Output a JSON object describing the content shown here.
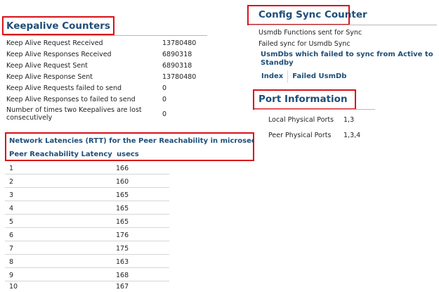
{
  "keepalive": {
    "title": "Keepalive Counters",
    "rows": [
      {
        "label": "Keep Alive Request Received",
        "value": "13780480"
      },
      {
        "label": "Keep Alive Responses Received",
        "value": "6890318"
      },
      {
        "label": "Keep Alive Request Sent",
        "value": "6890318"
      },
      {
        "label": "Keep Alive Response Sent",
        "value": "13780480"
      },
      {
        "label": "Keep Alive Requests failed to send",
        "value": "0"
      },
      {
        "label": "Keep Alive Responses to failed to send",
        "value": "0"
      },
      {
        "label": "Number of times two Keepalives are lost consecutively",
        "value": "0"
      }
    ]
  },
  "latency": {
    "title": "Network Latencies (RTT) for the Peer Reachability in microseconds",
    "col_latency": "Peer Reachability Latency",
    "col_usecs": "usecs",
    "rows": [
      {
        "n": "1",
        "v": "166"
      },
      {
        "n": "2",
        "v": "160"
      },
      {
        "n": "3",
        "v": "165"
      },
      {
        "n": "4",
        "v": "165"
      },
      {
        "n": "5",
        "v": "165"
      },
      {
        "n": "6",
        "v": "176"
      },
      {
        "n": "7",
        "v": "175"
      },
      {
        "n": "8",
        "v": "163"
      },
      {
        "n": "9",
        "v": "168"
      },
      {
        "n": "10",
        "v": "167"
      }
    ]
  },
  "config_sync": {
    "title": "Config Sync Counter",
    "sent_label": "Usmdb Functions sent for Sync",
    "failed_label": "Failed sync for Usmdb Sync",
    "failed_header": "UsmDbs which failed to sync from Active to Standby",
    "col_index": "Index",
    "col_failed": "Failed UsmDb"
  },
  "ports": {
    "title": "Port Information",
    "local_label": "Local Physical Ports",
    "local_value": "1,3",
    "peer_label": "Peer Physical Ports",
    "peer_value": "1,3,4"
  },
  "colors": {
    "heading": "#1f4e79",
    "highlight_box": "#d9111a"
  }
}
